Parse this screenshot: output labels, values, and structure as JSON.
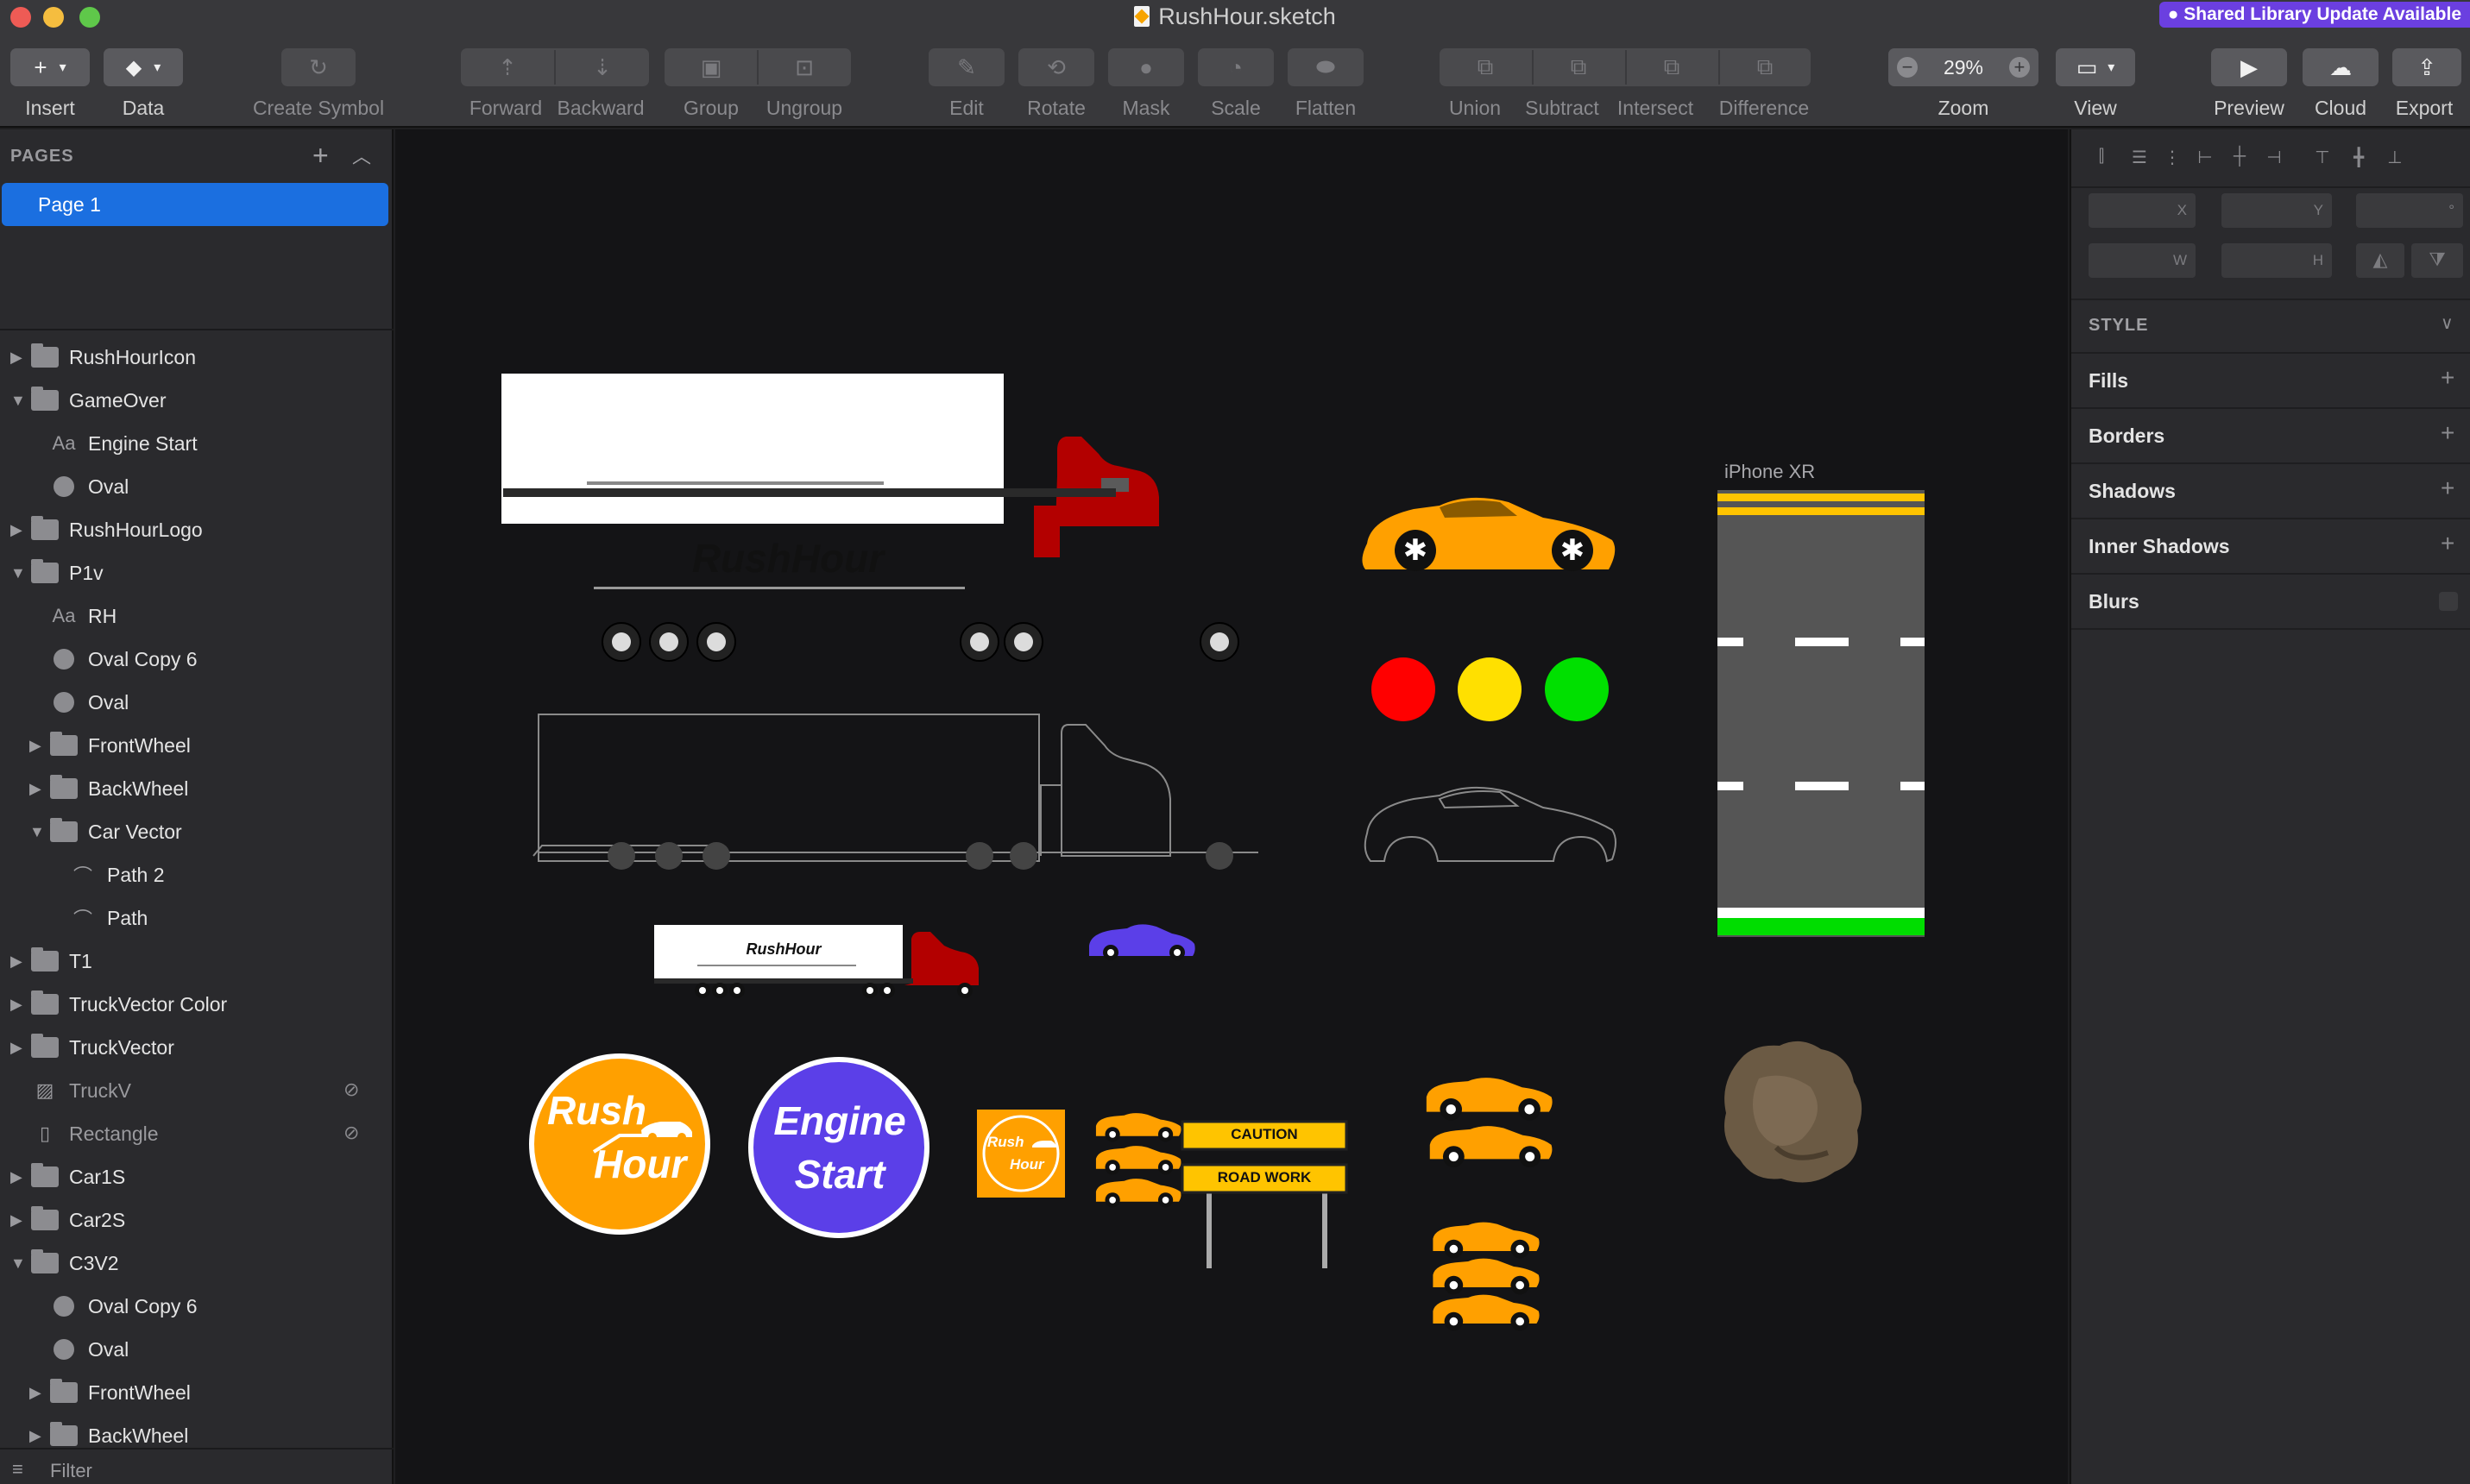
{
  "window": {
    "title": "RushHour.sketch",
    "library_badge": "Shared Library Update Available",
    "traffic_colors": [
      "#ee5b55",
      "#f5bd3f",
      "#5fc84a"
    ]
  },
  "toolbar": {
    "insert": "Insert",
    "data": "Data",
    "create_symbol": "Create Symbol",
    "forward": "Forward",
    "backward": "Backward",
    "group": "Group",
    "ungroup": "Ungroup",
    "edit": "Edit",
    "rotate": "Rotate",
    "mask": "Mask",
    "scale": "Scale",
    "flatten": "Flatten",
    "union": "Union",
    "subtract": "Subtract",
    "intersect": "Intersect",
    "difference": "Difference",
    "zoom": "Zoom",
    "zoom_value": "29%",
    "zoom_minus": "−",
    "zoom_plus": "+",
    "view": "View",
    "preview": "Preview",
    "cloud": "Cloud",
    "export": "Export"
  },
  "sidebar": {
    "pages_heading": "PAGES",
    "pages": [
      "Page 1"
    ],
    "layers": [
      {
        "label": "RushHourIcon",
        "type": "group",
        "indent": 0,
        "expanded": false
      },
      {
        "label": "GameOver",
        "type": "group",
        "indent": 0,
        "expanded": true
      },
      {
        "label": "Engine Start",
        "type": "text",
        "indent": 1
      },
      {
        "label": "Oval",
        "type": "oval",
        "indent": 1
      },
      {
        "label": "RushHourLogo",
        "type": "group",
        "indent": 0,
        "expanded": false
      },
      {
        "label": "P1v",
        "type": "group",
        "indent": 0,
        "expanded": true
      },
      {
        "label": "RH",
        "type": "text",
        "indent": 1
      },
      {
        "label": "Oval Copy 6",
        "type": "oval",
        "indent": 1
      },
      {
        "label": "Oval",
        "type": "oval",
        "indent": 1
      },
      {
        "label": "FrontWheel",
        "type": "group",
        "indent": 1,
        "expanded": false
      },
      {
        "label": "BackWheel",
        "type": "group",
        "indent": 1,
        "expanded": false
      },
      {
        "label": "Car Vector",
        "type": "group",
        "indent": 1,
        "expanded": true
      },
      {
        "label": "Path 2",
        "type": "path",
        "indent": 2
      },
      {
        "label": "Path",
        "type": "path",
        "indent": 2
      },
      {
        "label": "T1",
        "type": "group",
        "indent": 0,
        "expanded": false
      },
      {
        "label": "TruckVector Color",
        "type": "group",
        "indent": 0,
        "expanded": false
      },
      {
        "label": "TruckVector",
        "type": "group",
        "indent": 0,
        "expanded": false
      },
      {
        "label": "TruckV",
        "type": "image",
        "indent": 0,
        "hidden": true
      },
      {
        "label": "Rectangle",
        "type": "shape",
        "indent": 0,
        "hidden": true
      },
      {
        "label": "Car1S",
        "type": "group",
        "indent": 0,
        "expanded": false
      },
      {
        "label": "Car2S",
        "type": "group",
        "indent": 0,
        "expanded": false
      },
      {
        "label": "C3V2",
        "type": "group",
        "indent": 0,
        "expanded": true
      },
      {
        "label": "Oval Copy 6",
        "type": "oval",
        "indent": 1
      },
      {
        "label": "Oval",
        "type": "oval",
        "indent": 1
      },
      {
        "label": "FrontWheel",
        "type": "group",
        "indent": 1,
        "expanded": false
      },
      {
        "label": "BackWheel",
        "type": "group",
        "indent": 1,
        "expanded": false
      }
    ],
    "filter": "Filter"
  },
  "canvas": {
    "artboard_label": "iPhone XR",
    "truck_text": "RushHour",
    "small_truck_text": "RushHour",
    "logo_rush": "Rush",
    "logo_hour": "Hour",
    "engine_start_1": "Engine",
    "engine_start_2": "Start",
    "icon_rush": "Rush",
    "icon_hour": "Hour",
    "sign_caution": "CAUTION",
    "sign_roadwork": "ROAD WORK",
    "colors": {
      "orange": "#ffa000",
      "truck_red": "#b30000",
      "purple": "#5b3fe8",
      "light_red": "#ff0000",
      "light_yellow": "#ffe000",
      "light_green": "#00e000",
      "road": "#555555",
      "road_yellow": "#ffc400",
      "road_green": "#00dd00",
      "dirt": "#6b5a44"
    }
  },
  "inspector": {
    "x": "X",
    "y": "Y",
    "deg": "°",
    "w": "W",
    "h": "H",
    "style": "STYLE",
    "fills": "Fills",
    "borders": "Borders",
    "shadows": "Shadows",
    "inner_shadows": "Inner Shadows",
    "blurs": "Blurs"
  }
}
